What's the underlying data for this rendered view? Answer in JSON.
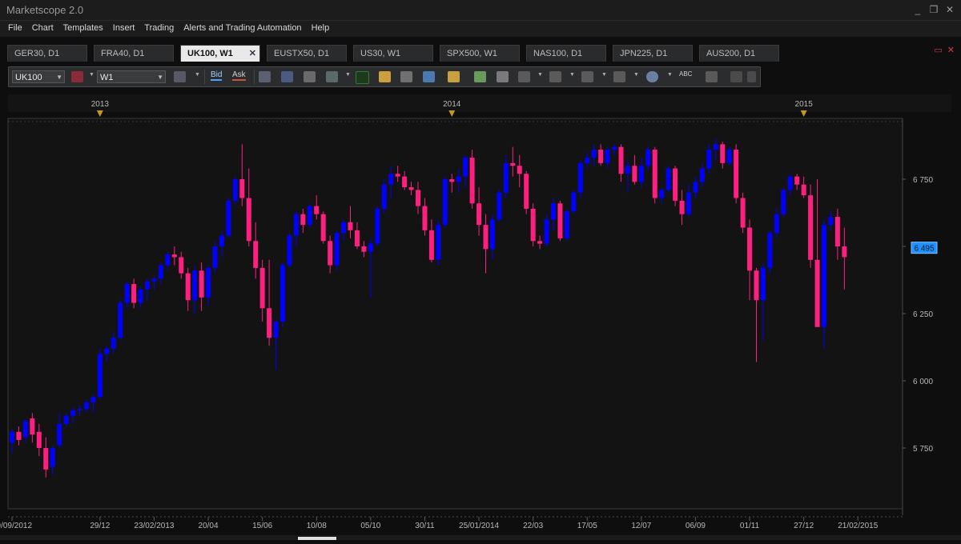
{
  "app": {
    "title": "Marketscope 2.0",
    "window_buttons": [
      "_",
      "❐",
      "✕"
    ]
  },
  "menu": [
    "File",
    "Chart",
    "Templates",
    "Insert",
    "Trading",
    "Alerts and Trading Automation",
    "Help"
  ],
  "tabs": [
    {
      "label": "GER30, D1",
      "active": false
    },
    {
      "label": "FRA40, D1",
      "active": false
    },
    {
      "label": "UK100, W1",
      "active": true
    },
    {
      "label": "EUSTX50, D1",
      "active": false
    },
    {
      "label": "US30, W1",
      "active": false
    },
    {
      "label": "SPX500, W1",
      "active": false
    },
    {
      "label": "NAS100, D1",
      "active": false
    },
    {
      "label": "JPN225, D1",
      "active": false
    },
    {
      "label": "AUS200, D1",
      "active": false
    }
  ],
  "tabs_controls": [
    "▭",
    "✕"
  ],
  "toolbar": {
    "instrument": "UK100",
    "timeframe": "W1",
    "bid_label": "Bid",
    "ask_label": "Ask",
    "abc_label": "ABC"
  },
  "chart_data": {
    "type": "candlestick",
    "instrument": "UK100",
    "timeframe": "W1",
    "price_label": "6 495",
    "y_ticks": [
      {
        "value": 6750,
        "label": "6 750"
      },
      {
        "value": 6500,
        "label": "6 500"
      },
      {
        "value": 6250,
        "label": "6 250"
      },
      {
        "value": 6000,
        "label": "6 000"
      },
      {
        "value": 5750,
        "label": "5 750"
      }
    ],
    "ylim": [
      5500,
      7000
    ],
    "years": [
      {
        "label": "2013",
        "week": 13
      },
      {
        "label": "2014",
        "week": 65
      },
      {
        "label": "2015",
        "week": 117
      }
    ],
    "x_labels": [
      {
        "label": "29/09/2012",
        "week": 0
      },
      {
        "label": "29/12",
        "week": 13
      },
      {
        "label": "23/02/2013",
        "week": 21
      },
      {
        "label": "20/04",
        "week": 29
      },
      {
        "label": "15/06",
        "week": 37
      },
      {
        "label": "10/08",
        "week": 45
      },
      {
        "label": "05/10",
        "week": 53
      },
      {
        "label": "30/11",
        "week": 61
      },
      {
        "label": "25/01/2014",
        "week": 69
      },
      {
        "label": "22/03",
        "week": 77
      },
      {
        "label": "17/05",
        "week": 85
      },
      {
        "label": "12/07",
        "week": 93
      },
      {
        "label": "06/09",
        "week": 101
      },
      {
        "label": "01/11",
        "week": 109
      },
      {
        "label": "27/12",
        "week": 117
      },
      {
        "label": "21/02/2015",
        "week": 125
      }
    ],
    "candles": [
      {
        "o": 5770,
        "h": 5820,
        "l": 5730,
        "c": 5810
      },
      {
        "o": 5810,
        "h": 5830,
        "l": 5760,
        "c": 5780
      },
      {
        "o": 5790,
        "h": 5860,
        "l": 5770,
        "c": 5850
      },
      {
        "o": 5860,
        "h": 5880,
        "l": 5770,
        "c": 5800
      },
      {
        "o": 5810,
        "h": 5840,
        "l": 5720,
        "c": 5750
      },
      {
        "o": 5750,
        "h": 5790,
        "l": 5640,
        "c": 5670
      },
      {
        "o": 5680,
        "h": 5760,
        "l": 5650,
        "c": 5750
      },
      {
        "o": 5760,
        "h": 5880,
        "l": 5750,
        "c": 5840
      },
      {
        "o": 5840,
        "h": 5880,
        "l": 5830,
        "c": 5870
      },
      {
        "o": 5870,
        "h": 5900,
        "l": 5840,
        "c": 5890
      },
      {
        "o": 5890,
        "h": 5910,
        "l": 5870,
        "c": 5895
      },
      {
        "o": 5895,
        "h": 5930,
        "l": 5880,
        "c": 5920
      },
      {
        "o": 5920,
        "h": 5950,
        "l": 5880,
        "c": 5940
      },
      {
        "o": 5940,
        "h": 6120,
        "l": 5930,
        "c": 6100
      },
      {
        "o": 6100,
        "h": 6130,
        "l": 6070,
        "c": 6120
      },
      {
        "o": 6120,
        "h": 6180,
        "l": 6100,
        "c": 6160
      },
      {
        "o": 6160,
        "h": 6300,
        "l": 6150,
        "c": 6290
      },
      {
        "o": 6290,
        "h": 6370,
        "l": 6270,
        "c": 6360
      },
      {
        "o": 6360,
        "h": 6380,
        "l": 6270,
        "c": 6290
      },
      {
        "o": 6290,
        "h": 6350,
        "l": 6270,
        "c": 6340
      },
      {
        "o": 6340,
        "h": 6380,
        "l": 6300,
        "c": 6370
      },
      {
        "o": 6370,
        "h": 6390,
        "l": 6340,
        "c": 6380
      },
      {
        "o": 6380,
        "h": 6440,
        "l": 6360,
        "c": 6430
      },
      {
        "o": 6430,
        "h": 6480,
        "l": 6410,
        "c": 6470
      },
      {
        "o": 6470,
        "h": 6500,
        "l": 6430,
        "c": 6460
      },
      {
        "o": 6460,
        "h": 6480,
        "l": 6380,
        "c": 6400
      },
      {
        "o": 6400,
        "h": 6420,
        "l": 6260,
        "c": 6300
      },
      {
        "o": 6300,
        "h": 6430,
        "l": 6250,
        "c": 6410
      },
      {
        "o": 6410,
        "h": 6440,
        "l": 6260,
        "c": 6310
      },
      {
        "o": 6310,
        "h": 6430,
        "l": 6280,
        "c": 6420
      },
      {
        "o": 6420,
        "h": 6520,
        "l": 6400,
        "c": 6500
      },
      {
        "o": 6500,
        "h": 6560,
        "l": 6460,
        "c": 6540
      },
      {
        "o": 6540,
        "h": 6680,
        "l": 6530,
        "c": 6670
      },
      {
        "o": 6670,
        "h": 6760,
        "l": 6650,
        "c": 6750
      },
      {
        "o": 6750,
        "h": 6880,
        "l": 6650,
        "c": 6680
      },
      {
        "o": 6680,
        "h": 6790,
        "l": 6500,
        "c": 6520
      },
      {
        "o": 6520,
        "h": 6590,
        "l": 6380,
        "c": 6420
      },
      {
        "o": 6420,
        "h": 6450,
        "l": 6220,
        "c": 6270
      },
      {
        "o": 6270,
        "h": 6450,
        "l": 6130,
        "c": 6160
      },
      {
        "o": 6160,
        "h": 6230,
        "l": 6040,
        "c": 6220
      },
      {
        "o": 6220,
        "h": 6440,
        "l": 6200,
        "c": 6430
      },
      {
        "o": 6430,
        "h": 6550,
        "l": 6420,
        "c": 6540
      },
      {
        "o": 6540,
        "h": 6630,
        "l": 6500,
        "c": 6620
      },
      {
        "o": 6620,
        "h": 6640,
        "l": 6550,
        "c": 6580
      },
      {
        "o": 6580,
        "h": 6660,
        "l": 6570,
        "c": 6650
      },
      {
        "o": 6650,
        "h": 6690,
        "l": 6600,
        "c": 6620
      },
      {
        "o": 6620,
        "h": 6630,
        "l": 6510,
        "c": 6520
      },
      {
        "o": 6520,
        "h": 6540,
        "l": 6400,
        "c": 6430
      },
      {
        "o": 6430,
        "h": 6560,
        "l": 6410,
        "c": 6550
      },
      {
        "o": 6550,
        "h": 6600,
        "l": 6520,
        "c": 6590
      },
      {
        "o": 6590,
        "h": 6650,
        "l": 6530,
        "c": 6560
      },
      {
        "o": 6560,
        "h": 6590,
        "l": 6490,
        "c": 6500
      },
      {
        "o": 6500,
        "h": 6520,
        "l": 6460,
        "c": 6480
      },
      {
        "o": 6480,
        "h": 6530,
        "l": 6310,
        "c": 6510
      },
      {
        "o": 6510,
        "h": 6650,
        "l": 6500,
        "c": 6640
      },
      {
        "o": 6640,
        "h": 6750,
        "l": 6620,
        "c": 6730
      },
      {
        "o": 6730,
        "h": 6800,
        "l": 6680,
        "c": 6770
      },
      {
        "o": 6770,
        "h": 6800,
        "l": 6740,
        "c": 6760
      },
      {
        "o": 6760,
        "h": 6780,
        "l": 6710,
        "c": 6720
      },
      {
        "o": 6720,
        "h": 6740,
        "l": 6690,
        "c": 6710
      },
      {
        "o": 6710,
        "h": 6740,
        "l": 6620,
        "c": 6650
      },
      {
        "o": 6650,
        "h": 6680,
        "l": 6540,
        "c": 6560
      },
      {
        "o": 6560,
        "h": 6600,
        "l": 6440,
        "c": 6450
      },
      {
        "o": 6450,
        "h": 6600,
        "l": 6430,
        "c": 6580
      },
      {
        "o": 6580,
        "h": 6760,
        "l": 6570,
        "c": 6750
      },
      {
        "o": 6750,
        "h": 6770,
        "l": 6700,
        "c": 6740
      },
      {
        "o": 6740,
        "h": 6790,
        "l": 6700,
        "c": 6760
      },
      {
        "o": 6760,
        "h": 6840,
        "l": 6720,
        "c": 6830
      },
      {
        "o": 6830,
        "h": 6860,
        "l": 6640,
        "c": 6660
      },
      {
        "o": 6660,
        "h": 6720,
        "l": 6540,
        "c": 6580
      },
      {
        "o": 6580,
        "h": 6620,
        "l": 6400,
        "c": 6490
      },
      {
        "o": 6490,
        "h": 6620,
        "l": 6450,
        "c": 6600
      },
      {
        "o": 6600,
        "h": 6710,
        "l": 6590,
        "c": 6700
      },
      {
        "o": 6700,
        "h": 6840,
        "l": 6680,
        "c": 6810
      },
      {
        "o": 6810,
        "h": 6870,
        "l": 6760,
        "c": 6800
      },
      {
        "o": 6800,
        "h": 6840,
        "l": 6720,
        "c": 6770
      },
      {
        "o": 6770,
        "h": 6780,
        "l": 6620,
        "c": 6640
      },
      {
        "o": 6640,
        "h": 6660,
        "l": 6500,
        "c": 6520
      },
      {
        "o": 6520,
        "h": 6540,
        "l": 6490,
        "c": 6510
      },
      {
        "o": 6510,
        "h": 6620,
        "l": 6500,
        "c": 6600
      },
      {
        "o": 6600,
        "h": 6680,
        "l": 6560,
        "c": 6660
      },
      {
        "o": 6660,
        "h": 6670,
        "l": 6520,
        "c": 6530
      },
      {
        "o": 6530,
        "h": 6640,
        "l": 6520,
        "c": 6630
      },
      {
        "o": 6630,
        "h": 6710,
        "l": 6620,
        "c": 6700
      },
      {
        "o": 6700,
        "h": 6820,
        "l": 6680,
        "c": 6810
      },
      {
        "o": 6810,
        "h": 6850,
        "l": 6790,
        "c": 6830
      },
      {
        "o": 6830,
        "h": 6880,
        "l": 6800,
        "c": 6860
      },
      {
        "o": 6860,
        "h": 6880,
        "l": 6800,
        "c": 6810
      },
      {
        "o": 6810,
        "h": 6870,
        "l": 6790,
        "c": 6860
      },
      {
        "o": 6860,
        "h": 6880,
        "l": 6840,
        "c": 6870
      },
      {
        "o": 6870,
        "h": 6880,
        "l": 6740,
        "c": 6770
      },
      {
        "o": 6770,
        "h": 6820,
        "l": 6700,
        "c": 6800
      },
      {
        "o": 6800,
        "h": 6840,
        "l": 6730,
        "c": 6740
      },
      {
        "o": 6740,
        "h": 6830,
        "l": 6720,
        "c": 6800
      },
      {
        "o": 6800,
        "h": 6870,
        "l": 6780,
        "c": 6860
      },
      {
        "o": 6860,
        "h": 6870,
        "l": 6660,
        "c": 6680
      },
      {
        "o": 6680,
        "h": 6720,
        "l": 6660,
        "c": 6710
      },
      {
        "o": 6710,
        "h": 6800,
        "l": 6700,
        "c": 6790
      },
      {
        "o": 6790,
        "h": 6800,
        "l": 6650,
        "c": 6670
      },
      {
        "o": 6670,
        "h": 6710,
        "l": 6580,
        "c": 6620
      },
      {
        "o": 6620,
        "h": 6730,
        "l": 6610,
        "c": 6700
      },
      {
        "o": 6700,
        "h": 6760,
        "l": 6680,
        "c": 6740
      },
      {
        "o": 6740,
        "h": 6810,
        "l": 6720,
        "c": 6790
      },
      {
        "o": 6790,
        "h": 6880,
        "l": 6770,
        "c": 6860
      },
      {
        "o": 6860,
        "h": 6900,
        "l": 6820,
        "c": 6880
      },
      {
        "o": 6880,
        "h": 6890,
        "l": 6790,
        "c": 6810
      },
      {
        "o": 6810,
        "h": 6870,
        "l": 6800,
        "c": 6860
      },
      {
        "o": 6860,
        "h": 6880,
        "l": 6660,
        "c": 6680
      },
      {
        "o": 6680,
        "h": 6700,
        "l": 6550,
        "c": 6570
      },
      {
        "o": 6570,
        "h": 6600,
        "l": 6300,
        "c": 6410
      },
      {
        "o": 6410,
        "h": 6420,
        "l": 6070,
        "c": 6300
      },
      {
        "o": 6300,
        "h": 6440,
        "l": 6150,
        "c": 6420
      },
      {
        "o": 6420,
        "h": 6560,
        "l": 6400,
        "c": 6550
      },
      {
        "o": 6550,
        "h": 6640,
        "l": 6530,
        "c": 6620
      },
      {
        "o": 6620,
        "h": 6720,
        "l": 6610,
        "c": 6710
      },
      {
        "o": 6710,
        "h": 6770,
        "l": 6690,
        "c": 6760
      },
      {
        "o": 6760,
        "h": 6770,
        "l": 6710,
        "c": 6730
      },
      {
        "o": 6730,
        "h": 6760,
        "l": 6680,
        "c": 6690
      },
      {
        "o": 6690,
        "h": 6730,
        "l": 6420,
        "c": 6450
      },
      {
        "o": 6450,
        "h": 6750,
        "l": 6420,
        "c": 6200
      },
      {
        "o": 6200,
        "h": 6600,
        "l": 6120,
        "c": 6580
      },
      {
        "o": 6580,
        "h": 6630,
        "l": 6560,
        "c": 6610
      },
      {
        "o": 6610,
        "h": 6640,
        "l": 6450,
        "c": 6500
      },
      {
        "o": 6500,
        "h": 6570,
        "l": 6340,
        "c": 6460
      }
    ]
  }
}
